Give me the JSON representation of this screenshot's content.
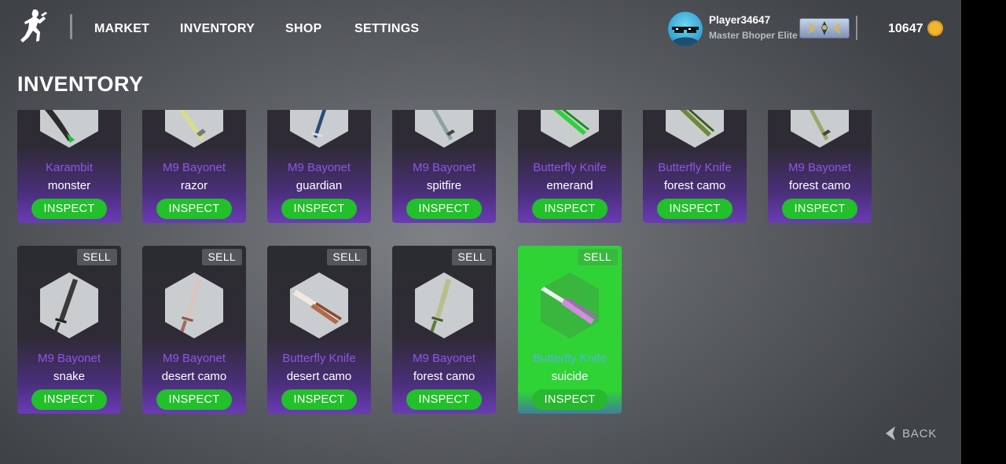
{
  "nav": {
    "items": [
      "MARKET",
      "INVENTORY",
      "SHOP",
      "SETTINGS"
    ]
  },
  "player": {
    "name": "Player34647",
    "title": "Master Bhoper Elite",
    "coins": "10647",
    "coin_icon": "coin-icon",
    "rank_icon": "rank-badge-icon"
  },
  "page": {
    "title": "INVENTORY"
  },
  "inventory": {
    "row1": [
      {
        "weapon": "Karambit",
        "skin": "monster",
        "inspect": "INSPECT"
      },
      {
        "weapon": "M9 Bayonet",
        "skin": "razor",
        "inspect": "INSPECT"
      },
      {
        "weapon": "M9 Bayonet",
        "skin": "guardian",
        "inspect": "INSPECT"
      },
      {
        "weapon": "M9 Bayonet",
        "skin": "spitfire",
        "inspect": "INSPECT"
      },
      {
        "weapon": "Butterfly Knife",
        "skin": "emerand",
        "inspect": "INSPECT"
      },
      {
        "weapon": "Butterfly Knife",
        "skin": "forest camo",
        "inspect": "INSPECT"
      },
      {
        "weapon": "M9 Bayonet",
        "skin": "forest camo",
        "inspect": "INSPECT"
      }
    ],
    "row2": [
      {
        "weapon": "M9 Bayonet",
        "skin": "snake",
        "sell": "SELL",
        "inspect": "INSPECT",
        "selected": false
      },
      {
        "weapon": "M9 Bayonet",
        "skin": "desert camo",
        "sell": "SELL",
        "inspect": "INSPECT",
        "selected": false
      },
      {
        "weapon": "Butterfly Knife",
        "skin": "desert camo",
        "sell": "SELL",
        "inspect": "INSPECT",
        "selected": false
      },
      {
        "weapon": "M9 Bayonet",
        "skin": "forest camo",
        "sell": "SELL",
        "inspect": "INSPECT",
        "selected": false
      },
      {
        "weapon": "Butterfly Knife",
        "skin": "suicide",
        "sell": "SELL",
        "inspect": "INSPECT",
        "selected": true
      }
    ]
  },
  "footer": {
    "back": "BACK"
  },
  "colors": {
    "accent_green": "#22c02a",
    "weapon_purple": "#8f55e8",
    "selected_green": "#2fd336",
    "coin_gold": "#f2b531"
  }
}
